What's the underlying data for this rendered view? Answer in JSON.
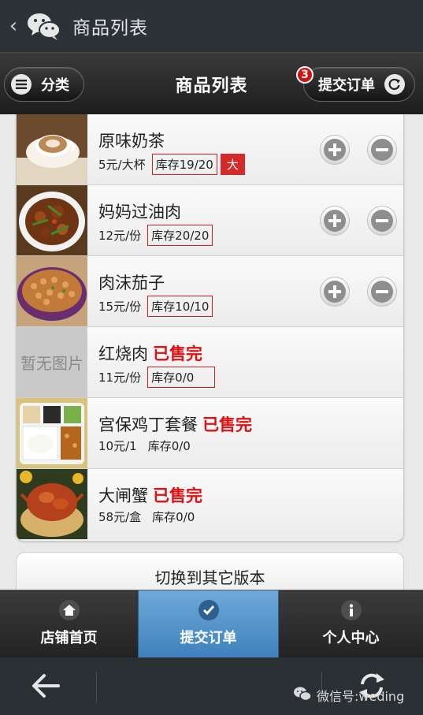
{
  "wechat_bar": {
    "title": "商品列表"
  },
  "header": {
    "category_label": "分类",
    "title": "商品列表",
    "submit_label": "提交订单",
    "badge_count": "3"
  },
  "products": [
    {
      "name": "原味奶茶",
      "soldout": "",
      "price": "5元/大杯",
      "stock": "库存19/20",
      "tag": "大"
    },
    {
      "name": "妈妈过油肉",
      "soldout": "",
      "price": "12元/份",
      "stock": "库存20/20"
    },
    {
      "name": "肉沫茄子",
      "soldout": "",
      "price": "15元/份",
      "stock": "库存10/10"
    },
    {
      "name": "红烧肉",
      "soldout": "已售完",
      "price": "11元/份",
      "stock": "库存0/0",
      "placeholder": "暂无图片"
    },
    {
      "name": "宫保鸡丁套餐",
      "soldout": "已售完",
      "price": "10元/1",
      "stock": "库存0/0"
    },
    {
      "name": "大闸蟹",
      "soldout": "已售完",
      "price": "58元/盒",
      "stock": "库存0/0"
    }
  ],
  "switch_label": "切换到其它版本",
  "nav": [
    {
      "label": "店铺首页",
      "icon": "home-icon"
    },
    {
      "label": "提交订单",
      "icon": "check-icon"
    },
    {
      "label": "个人中心",
      "icon": "info-icon"
    }
  ],
  "watermark": "微信号:weding"
}
